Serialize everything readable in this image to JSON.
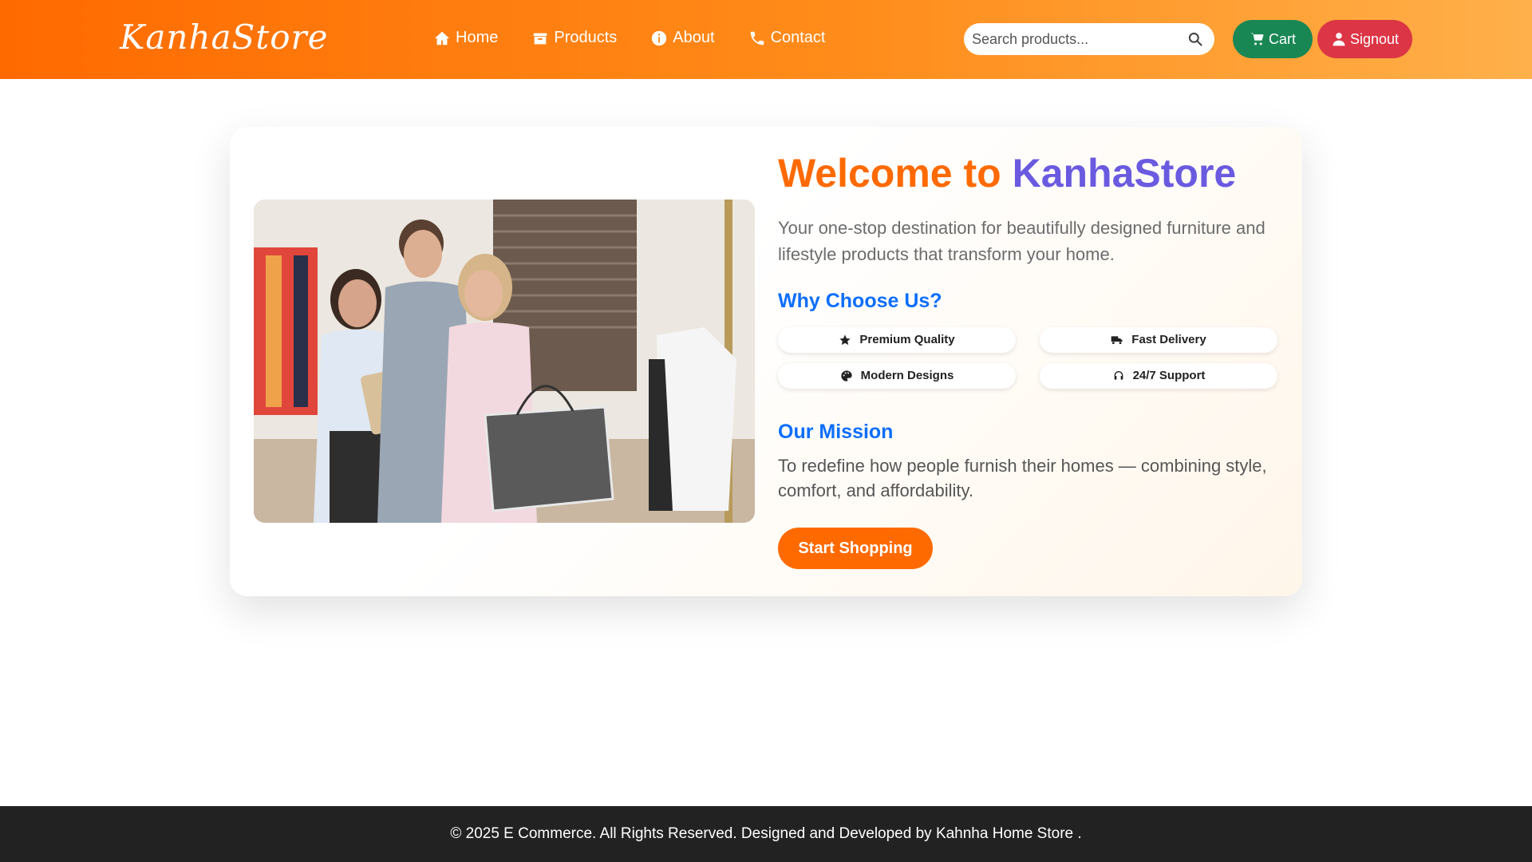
{
  "brand": {
    "name": "KanhaStore"
  },
  "nav": {
    "items": [
      {
        "label": "Home",
        "icon": "home-icon"
      },
      {
        "label": "Products",
        "icon": "box-icon"
      },
      {
        "label": "About",
        "icon": "info-icon"
      },
      {
        "label": "Contact",
        "icon": "phone-icon"
      }
    ]
  },
  "search": {
    "placeholder": "Search products...",
    "value": ""
  },
  "actions": {
    "cart_label": "Cart",
    "signout_label": "Signout"
  },
  "hero": {
    "title_part1": "Welcome to",
    "title_part2": "KanhaStore",
    "tagline": "Your one-stop destination for beautifully designed furniture and lifestyle products that transform your home.",
    "why_heading": "Why Choose Us?",
    "features": [
      {
        "label": "Premium Quality",
        "icon": "star-icon"
      },
      {
        "label": "Fast Delivery",
        "icon": "truck-icon"
      },
      {
        "label": "Modern Designs",
        "icon": "palette-icon"
      },
      {
        "label": "24/7 Support",
        "icon": "headset-icon"
      }
    ],
    "mission_heading": "Our Mission",
    "mission_text": "To redefine how people furnish their homes — combining style, comfort, and affordability.",
    "cta_label": "Start Shopping"
  },
  "footer": {
    "text": "© 2025 E Commerce. All Rights Reserved. Designed and Developed by Kahnha Home Store ."
  },
  "colors": {
    "nav_gradient_start": "#ff6a00",
    "nav_gradient_end": "#ffb04a",
    "cart_button": "#198754",
    "signout_button": "#dc3545",
    "accent_orange": "#ff6a00",
    "accent_purple": "#6a5ae0",
    "heading_blue": "#0d6efd",
    "footer_bg": "#222222"
  }
}
